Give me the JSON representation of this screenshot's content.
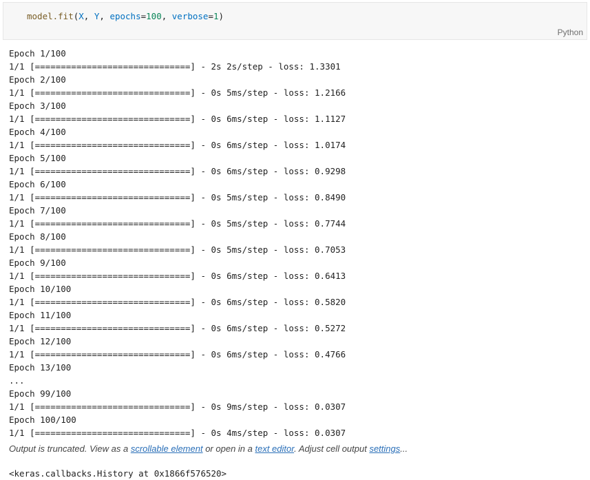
{
  "cell": {
    "code": {
      "fn": "model.fit",
      "open": "(",
      "arg1": "X",
      "sep1": ", ",
      "arg2": "Y",
      "sep2": ", ",
      "p1_name": "epochs",
      "eq1": "=",
      "p1_val": "100",
      "sep3": ", ",
      "p2_name": "verbose",
      "eq2": "=",
      "p2_val": "1",
      "close": ")"
    },
    "language": "Python"
  },
  "output": {
    "lines": [
      "Epoch 1/100",
      "1/1 [==============================] - 2s 2s/step - loss: 1.3301",
      "Epoch 2/100",
      "1/1 [==============================] - 0s 5ms/step - loss: 1.2166",
      "Epoch 3/100",
      "1/1 [==============================] - 0s 6ms/step - loss: 1.1127",
      "Epoch 4/100",
      "1/1 [==============================] - 0s 6ms/step - loss: 1.0174",
      "Epoch 5/100",
      "1/1 [==============================] - 0s 6ms/step - loss: 0.9298",
      "Epoch 6/100",
      "1/1 [==============================] - 0s 5ms/step - loss: 0.8490",
      "Epoch 7/100",
      "1/1 [==============================] - 0s 5ms/step - loss: 0.7744",
      "Epoch 8/100",
      "1/1 [==============================] - 0s 5ms/step - loss: 0.7053",
      "Epoch 9/100",
      "1/1 [==============================] - 0s 6ms/step - loss: 0.6413",
      "Epoch 10/100",
      "1/1 [==============================] - 0s 6ms/step - loss: 0.5820",
      "Epoch 11/100",
      "1/1 [==============================] - 0s 6ms/step - loss: 0.5272",
      "Epoch 12/100",
      "1/1 [==============================] - 0s 6ms/step - loss: 0.4766",
      "Epoch 13/100",
      "...",
      "Epoch 99/100",
      "1/1 [==============================] - 0s 9ms/step - loss: 0.0307",
      "Epoch 100/100",
      "1/1 [==============================] - 0s 4ms/step - loss: 0.0307"
    ],
    "truncation": {
      "prefix": "Output is truncated. View as a ",
      "link_scrollable": "scrollable element",
      "middle": " or open in a ",
      "link_editor": "text editor",
      "middle2": ". Adjust cell output ",
      "link_settings": "settings",
      "suffix": "..."
    },
    "result": "<keras.callbacks.History at 0x1866f576520>"
  }
}
